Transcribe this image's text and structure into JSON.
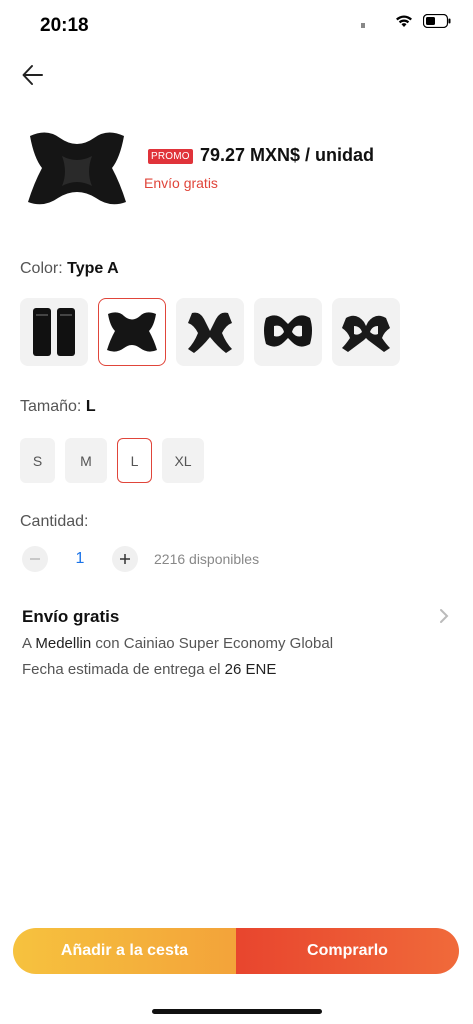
{
  "status_bar": {
    "time": "20:18"
  },
  "product": {
    "promo_label": "PROMO",
    "price": "79.27 MXN$ / unidad",
    "shipping_note": "Envío gratis"
  },
  "color": {
    "label": "Color:",
    "selected": "Type A",
    "options": [
      {
        "icon": "sleeve-brace-icon"
      },
      {
        "icon": "back-brace-type-a-icon",
        "selected": true
      },
      {
        "icon": "back-brace-type-b-icon"
      },
      {
        "icon": "back-brace-type-c-icon"
      },
      {
        "icon": "back-brace-type-d-icon"
      }
    ]
  },
  "size": {
    "label": "Tamaño:",
    "selected": "L",
    "options": [
      "S",
      "M",
      "L",
      "XL"
    ]
  },
  "quantity": {
    "label": "Cantidad:",
    "value": "1",
    "available": "2216 disponibles"
  },
  "shipping": {
    "title": "Envío gratis",
    "line1_prefix": "A",
    "line1_city": "Medellin",
    "line1_suffix": "con Cainiao Super Economy Global",
    "line2_prefix": "Fecha estimada de entrega el",
    "line2_date": "26 ENE"
  },
  "actions": {
    "add_to_cart": "Añadir a la cesta",
    "buy": "Comprarlo"
  },
  "colors": {
    "accent": "#e0453a",
    "cart_start": "#f6c23e",
    "buy_start": "#e8452e"
  }
}
